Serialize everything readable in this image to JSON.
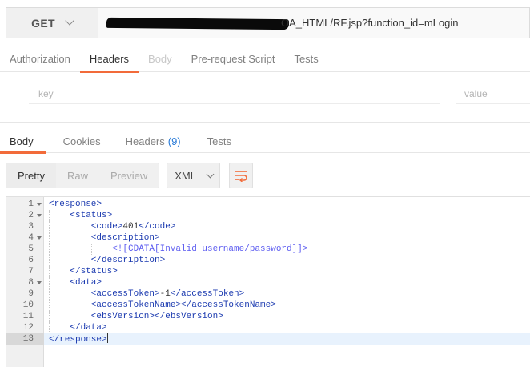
{
  "request": {
    "method": "GET",
    "url_visible": "OA_HTML/RF.jsp?function_id=mLogin"
  },
  "request_tabs": [
    {
      "label": "Authorization",
      "state": "normal"
    },
    {
      "label": "Headers",
      "state": "active"
    },
    {
      "label": "Body",
      "state": "disabled"
    },
    {
      "label": "Pre-request Script",
      "state": "normal"
    },
    {
      "label": "Tests",
      "state": "normal"
    }
  ],
  "headers_editor": {
    "key_placeholder": "key",
    "value_placeholder": "value"
  },
  "response_tabs": [
    {
      "label": "Body",
      "state": "active"
    },
    {
      "label": "Cookies",
      "state": "normal"
    },
    {
      "label": "Headers",
      "count": "(9)",
      "state": "normal"
    },
    {
      "label": "Tests",
      "state": "normal"
    }
  ],
  "view_modes": [
    {
      "label": "Pretty",
      "state": "active"
    },
    {
      "label": "Raw",
      "state": "normal"
    },
    {
      "label": "Preview",
      "state": "normal"
    }
  ],
  "format": {
    "selected": "XML"
  },
  "icons": {
    "method_dropdown": "chevron-down-icon",
    "format_dropdown": "chevron-down-icon",
    "wrap": "wrap-lines-icon"
  },
  "colors": {
    "accent": "#f26b3a",
    "tag": "#1c3bb0",
    "cdata": "#5c5cf0",
    "count": "#2a7bd8"
  },
  "response_body": [
    {
      "n": "1",
      "fold": true,
      "indent": 0,
      "parts": [
        [
          "tag",
          "<response>"
        ]
      ]
    },
    {
      "n": "2",
      "fold": true,
      "indent": 1,
      "parts": [
        [
          "tag",
          "<status>"
        ]
      ]
    },
    {
      "n": "3",
      "fold": false,
      "indent": 2,
      "parts": [
        [
          "tag",
          "<code>"
        ],
        [
          "txt",
          "401"
        ],
        [
          "tag",
          "</code>"
        ]
      ]
    },
    {
      "n": "4",
      "fold": true,
      "indent": 2,
      "parts": [
        [
          "tag",
          "<description>"
        ]
      ]
    },
    {
      "n": "5",
      "fold": false,
      "indent": 3,
      "parts": [
        [
          "cdata",
          "<![CDATA[Invalid username/password]]>"
        ]
      ]
    },
    {
      "n": "6",
      "fold": false,
      "indent": 2,
      "parts": [
        [
          "tag",
          "</description>"
        ]
      ]
    },
    {
      "n": "7",
      "fold": false,
      "indent": 1,
      "parts": [
        [
          "tag",
          "</status>"
        ]
      ]
    },
    {
      "n": "8",
      "fold": true,
      "indent": 1,
      "parts": [
        [
          "tag",
          "<data>"
        ]
      ]
    },
    {
      "n": "9",
      "fold": false,
      "indent": 2,
      "parts": [
        [
          "tag",
          "<accessToken>"
        ],
        [
          "txt",
          "-1"
        ],
        [
          "tag",
          "</accessToken>"
        ]
      ]
    },
    {
      "n": "10",
      "fold": false,
      "indent": 2,
      "parts": [
        [
          "tag",
          "<accessTokenName></accessTokenName>"
        ]
      ]
    },
    {
      "n": "11",
      "fold": false,
      "indent": 2,
      "parts": [
        [
          "tag",
          "<ebsVersion></ebsVersion>"
        ]
      ]
    },
    {
      "n": "12",
      "fold": false,
      "indent": 1,
      "parts": [
        [
          "tag",
          "</data>"
        ]
      ]
    },
    {
      "n": "13",
      "fold": false,
      "indent": 0,
      "current": true,
      "parts": [
        [
          "tag",
          "</response>"
        ]
      ]
    }
  ]
}
